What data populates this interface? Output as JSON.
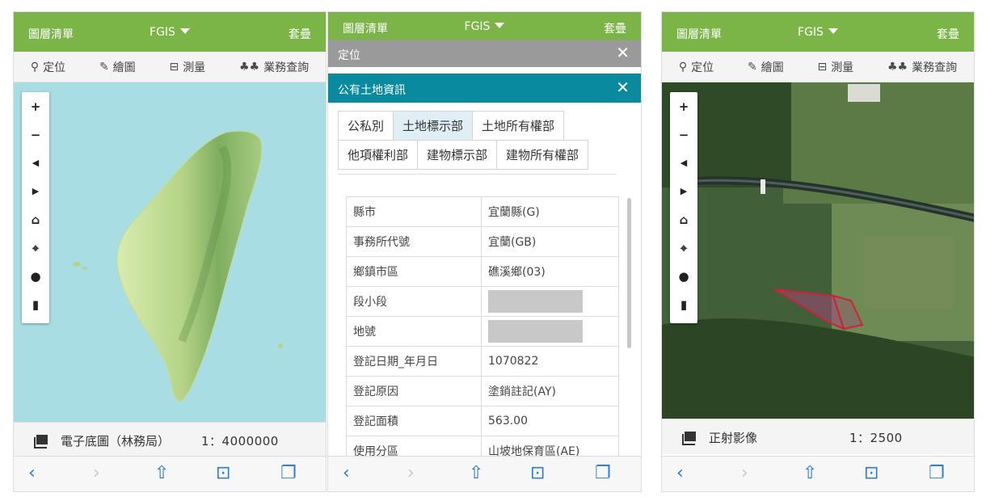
{
  "panel1": {
    "appbar": {
      "left": "圖層清單",
      "center": "FGIS",
      "right": "套疊"
    },
    "toolbar": [
      {
        "label": "定位",
        "icon": "person-pin-icon"
      },
      {
        "label": "繪圖",
        "icon": "brush-icon"
      },
      {
        "label": "測量",
        "icon": "ruler-icon"
      },
      {
        "label": "業務查詢",
        "icon": "trees-icon"
      }
    ],
    "map_controls": [
      "+",
      "−",
      "◀",
      "▶",
      "home",
      "target",
      "info",
      "marker"
    ],
    "status": {
      "layer": "電子底圖（林務局）",
      "scale": "1：4000000"
    }
  },
  "panel2": {
    "appbar": {
      "left": "圖層清單",
      "center": "FGIS",
      "right": "套疊"
    },
    "locate_bar": {
      "title": "定位"
    },
    "dialog": {
      "title": "公有土地資訊",
      "tabs_row1": [
        "公私別",
        "土地標示部",
        "土地所有權部"
      ],
      "tabs_row2": [
        "他項權利部",
        "建物標示部",
        "建物所有權部"
      ],
      "active_tab": "土地標示部",
      "rows": [
        {
          "key": "縣市",
          "value": "宜蘭縣(G)"
        },
        {
          "key": "事務所代號",
          "value": "宜蘭(GB)"
        },
        {
          "key": "鄉鎮市區",
          "value": "礁溪鄉(03)"
        },
        {
          "key": "段小段",
          "value": ""
        },
        {
          "key": "地號",
          "value": ""
        },
        {
          "key": "登記日期_年月日",
          "value": "1070822"
        },
        {
          "key": "登記原因",
          "value": "塗銷註記(AY)"
        },
        {
          "key": "登記面積",
          "value": "563.00"
        },
        {
          "key": "使用分區",
          "value": "山坡地保育區(AE)"
        }
      ]
    }
  },
  "panel3": {
    "appbar": {
      "left": "圖層清單",
      "center": "FGIS",
      "right": "套疊"
    },
    "toolbar": [
      {
        "label": "定位",
        "icon": "person-pin-icon"
      },
      {
        "label": "繪圖",
        "icon": "brush-icon"
      },
      {
        "label": "測量",
        "icon": "ruler-icon"
      },
      {
        "label": "業務查詢",
        "icon": "trees-icon"
      }
    ],
    "status": {
      "layer": "正射影像",
      "scale": "1：2500"
    }
  },
  "ios_bar": [
    "‹",
    "›",
    "share",
    "book",
    "tabs"
  ],
  "colors": {
    "appbar": "#7bb447",
    "dialog_header": "#0a8a9e",
    "ios_blue": "#2a7bd6",
    "parcel_outline": "#d0203a"
  }
}
